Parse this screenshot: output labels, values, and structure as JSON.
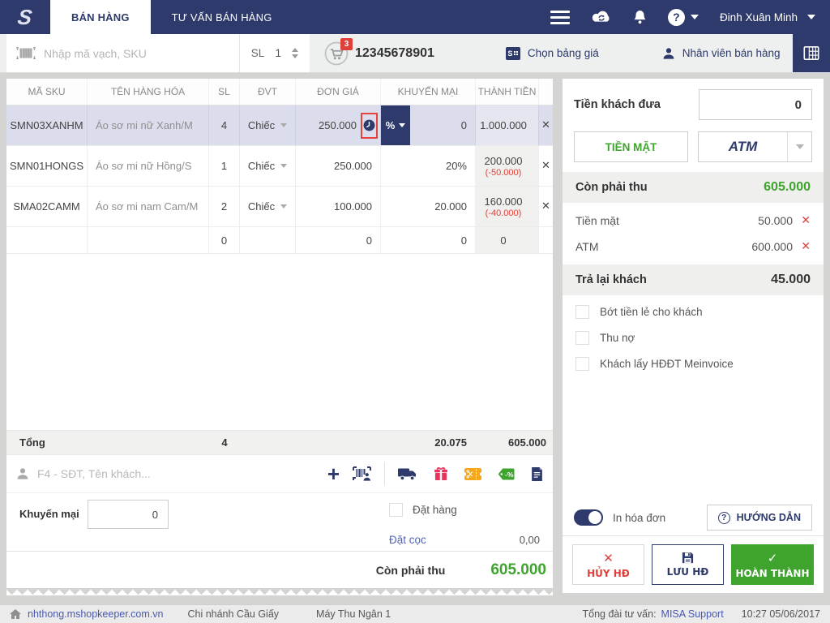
{
  "topbar": {
    "tabs": [
      {
        "label": "BÁN HÀNG"
      },
      {
        "label": "TƯ VẤN BÁN HÀNG"
      }
    ],
    "user_name": "Đinh Xuân Minh"
  },
  "toolbar": {
    "search_placeholder": "Nhập mã vạch, SKU",
    "qty_label": "SL",
    "qty_value": "1",
    "cart_badge": "3",
    "phone": "12345678901",
    "price_list_label": "Chọn bảng giá",
    "staff_label": "Nhân viên bán hàng"
  },
  "icons": {
    "logo": "S",
    "help": "?",
    "check": "✓",
    "close": "✕",
    "plus": "+",
    "price_table_letter": "S",
    "tag_text": "-%"
  },
  "table": {
    "headers": [
      "MÃ SKU",
      "TÊN HÀNG HÓA",
      "SL",
      "ĐVT",
      "ĐƠN GIÁ",
      "KHUYẾN MẠI",
      "THÀNH TIỀN"
    ],
    "rows": [
      {
        "sku": "SMN03XANHM",
        "name": "Áo sơ mi nữ Xanh/M",
        "qty": "4",
        "unit": "Chiếc",
        "price": "250.000",
        "promo_unit": "%",
        "promo_value": "0",
        "total": "1.000.000",
        "discount": ""
      },
      {
        "sku": "SMN01HONGS",
        "name": "Áo sơ mi nữ Hồng/S",
        "qty": "1",
        "unit": "Chiếc",
        "price": "250.000",
        "promo_value": "20%",
        "total": "200.000",
        "discount": "(-50.000)"
      },
      {
        "sku": "SMA02CAMM",
        "name": "Áo sơ mi nam Cam/M",
        "qty": "2",
        "unit": "Chiếc",
        "price": "100.000",
        "promo_value": "20.000",
        "total": "160.000",
        "discount": "(-40.000)"
      },
      {
        "sku": "",
        "name": "",
        "qty": "0",
        "unit": "",
        "price": "0",
        "promo_value": "0",
        "total": "0",
        "discount": ""
      }
    ],
    "totals": {
      "label": "Tổng",
      "qty": "4",
      "promo": "20.075",
      "amount": "605.000"
    }
  },
  "customer": {
    "placeholder": "F4 - SĐT, Tên khách..."
  },
  "order_footer": {
    "promo_label": "Khuyến mại",
    "promo_value": "0",
    "order_checkbox_label": "Đặt hàng",
    "deposit_label": "Đặt cọc",
    "deposit_value": "0,00",
    "due_label": "Còn phải thu",
    "due_value": "605.000"
  },
  "payment": {
    "customer_pay_label": "Tiền khách đưa",
    "customer_pay_value": "0",
    "cash_button": "TIỀN MẶT",
    "atm_button": "ATM",
    "due_label": "Còn phải thu",
    "due_value": "605.000",
    "lines": [
      {
        "label": "Tiền mặt",
        "value": "50.000"
      },
      {
        "label": "ATM",
        "value": "600.000"
      }
    ],
    "change_label": "Trả lại khách",
    "change_value": "45.000",
    "checkboxes": [
      "Bớt tiền lẻ cho khách",
      "Thu nợ",
      "Khách lấy HĐĐT Meinvoice"
    ],
    "print_label": "In hóa đơn",
    "guide_button": "HƯỚNG DẪN",
    "cancel_button": "HỦY HĐ",
    "save_button": "LƯU HĐ",
    "complete_button": "HOÀN THÀNH"
  },
  "statusbar": {
    "domain": "nhthong.mshopkeeper.com.vn",
    "branch": "Chi nhánh Cầu Giấy",
    "pos": "Máy Thu Ngân 1",
    "support_label": "Tổng đài tư vấn:",
    "support_link": "MISA Support",
    "datetime": "10:27 05/06/2017"
  },
  "colors": {
    "navy": "#2d3a6b",
    "green": "#3fa42e",
    "red": "#e0403a",
    "selected_row": "#dbddec",
    "link_blue": "#4a5aad",
    "gift_pink": "#e8335a",
    "coupon_orange": "#f5a81c",
    "highlight_red": "#e5433e"
  }
}
